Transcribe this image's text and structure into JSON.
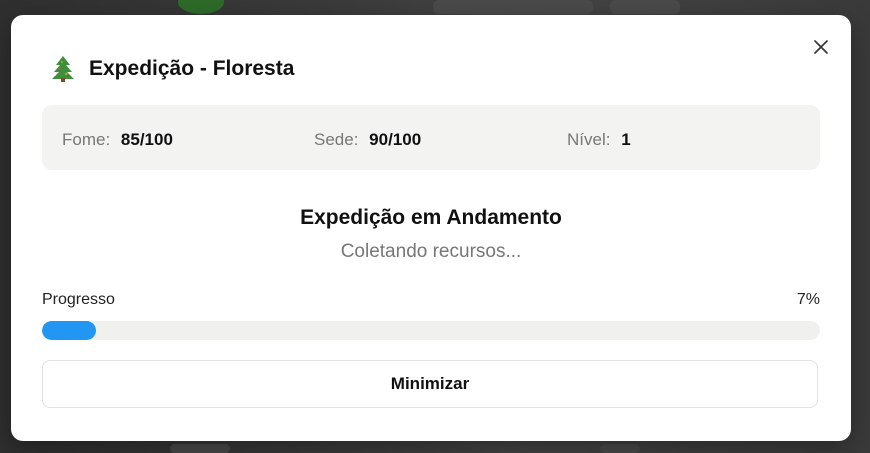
{
  "modal": {
    "title": "Expedição - Floresta",
    "title_icon": "tree-icon"
  },
  "stats": [
    {
      "label": "Fome:",
      "value": "85/100"
    },
    {
      "label": "Sede:",
      "value": "90/100"
    },
    {
      "label": "Nível:",
      "value": "1"
    }
  ],
  "status": {
    "heading": "Expedição em Andamento",
    "subtext": "Coletando recursos..."
  },
  "progress": {
    "label": "Progresso",
    "percent_text": "7%",
    "value": 0.07
  },
  "actions": {
    "minimize_label": "Minimizar"
  },
  "colors": {
    "progress_fill": "#2196f3",
    "stats_background": "#f3f3f2"
  }
}
